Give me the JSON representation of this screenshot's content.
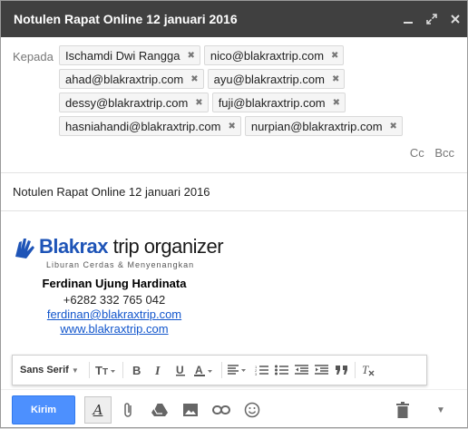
{
  "window": {
    "title": "Notulen Rapat Online 12 januari 2016",
    "controls": [
      "_",
      "⤢",
      "✕"
    ]
  },
  "to": {
    "label": "Kepada",
    "recipients": [
      "Ischamdi Dwi Rangga",
      "nico@blakraxtrip.com",
      "ahad@blakraxtrip.com",
      "ayu@blakraxtrip.com",
      "dessy@blakraxtrip.com",
      "fuji@blakraxtrip.com",
      "hasniahandi@blakraxtrip.com",
      "nurpian@blakraxtrip.com"
    ],
    "remove_glyph": "✖",
    "cc": "Cc",
    "bcc": "Bcc"
  },
  "subject": "Notulen Rapat Online 12 januari 2016",
  "signature": {
    "brand_main": "Blakrax",
    "brand_sub": " trip organizer",
    "tagline": "Liburan Cerdas & Menyenangkan",
    "name": "Ferdinan Ujung Hardinata",
    "phone": "+6282 332 765 042",
    "email": "ferdinan@blakraxtrip.com",
    "website": "www.blakraxtrip.com",
    "brand_color": "#1e54b7"
  },
  "format_toolbar": {
    "font": "Sans Serif"
  },
  "bottom": {
    "send_label": "Kirim",
    "accent": "#4d90fe"
  }
}
